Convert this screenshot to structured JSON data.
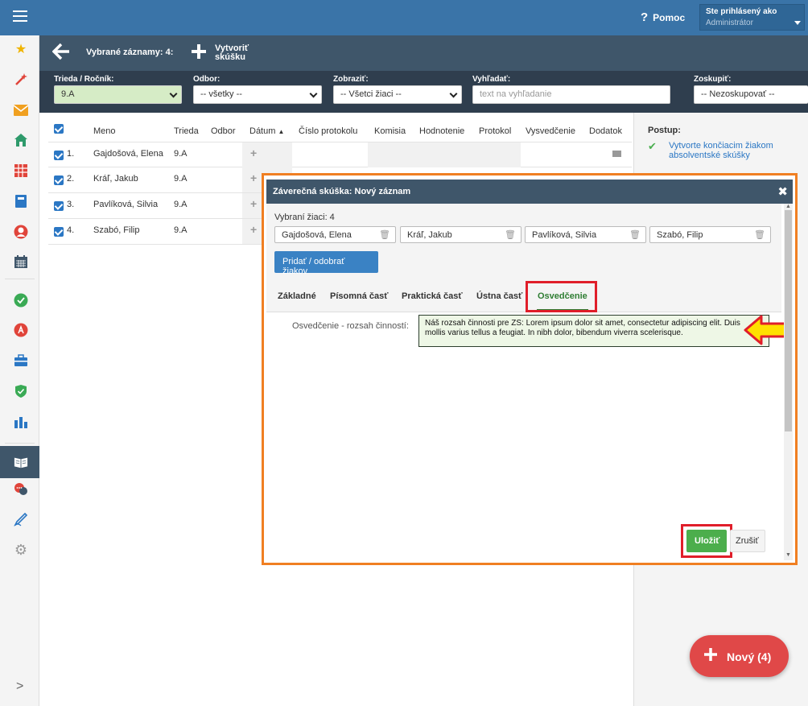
{
  "header": {
    "help_label": "Pomoc",
    "help_icon": "?",
    "user_status": "Ste prihlásený ako",
    "user_role": "Administrátor"
  },
  "actionbar": {
    "selected_label": "Vybrané záznamy: 4:",
    "create_label": "Vytvoriť skúšku"
  },
  "filters": {
    "class": {
      "label": "Trieda / Ročník:",
      "value": "9.A"
    },
    "field": {
      "label": "Odbor:",
      "value": "-- všetky --"
    },
    "show": {
      "label": "Zobraziť:",
      "value": "-- Všetci žiaci --"
    },
    "search": {
      "label": "Vyhľadať:",
      "placeholder": "text na vyhľadanie"
    },
    "group": {
      "label": "Zoskupiť:",
      "value": "-- Nezoskupovať --"
    }
  },
  "table": {
    "headers": [
      "Meno",
      "Trieda",
      "Odbor",
      "Dátum",
      "Číslo protokolu",
      "Komisia",
      "Hodnotenie",
      "Protokol",
      "Vysvedčenie",
      "Dodatok"
    ],
    "rows": [
      {
        "num": "1.",
        "name": "Gajdošová, Elena",
        "class": "9.A"
      },
      {
        "num": "2.",
        "name": "Kráľ, Jakub",
        "class": "9.A"
      },
      {
        "num": "3.",
        "name": "Pavlíková, Silvia",
        "class": "9.A"
      },
      {
        "num": "4.",
        "name": "Szabó, Filip",
        "class": "9.A"
      }
    ]
  },
  "rightpanel": {
    "title": "Postup:",
    "step": "Vytvorte končiacim žiakom absolventské skúšky"
  },
  "modal": {
    "title": "Záverečná skúška: Nový záznam",
    "selected_count": "Vybraní žiaci: 4",
    "students": [
      "Gajdošová, Elena",
      "Kráľ, Jakub",
      "Pavlíková, Silvia",
      "Szabó, Filip"
    ],
    "add_remove": "Pridať / odobrať žiakov",
    "tabs": [
      "Základné",
      "Písomná časť",
      "Praktická časť",
      "Ústna časť",
      "Osvedčenie"
    ],
    "field_label": "Osvedčenie - rozsah činností:",
    "field_value": "Náš rozsah činnosti pre ZS: Lorem ipsum dolor sit amet, consectetur adipiscing elit. Duis mollis varius tellus a feugiat. In nibh dolor, bibendum viverra scelerisque.",
    "save": "Uložiť",
    "cancel": "Zrušiť"
  },
  "fab": {
    "label": "Nový (4)"
  },
  "colors": {
    "primary": "#3a74a8",
    "dark": "#3f566a",
    "highlight_orange": "#f07f22",
    "highlight_red": "#e01e2a",
    "save_green": "#4cae4c",
    "fab_red": "#e04848"
  },
  "icons": {
    "sidebar": [
      "star-icon",
      "magic-wand-icon",
      "mail-icon",
      "home-icon",
      "grid-icon",
      "book-icon",
      "user-icon",
      "calendar-icon",
      "check-circle-icon",
      "grade-icon",
      "briefcase-icon",
      "shield-icon",
      "bar-chart-icon",
      "open-book-icon",
      "chat-icon",
      "pen-icon",
      "gear-icon"
    ]
  }
}
